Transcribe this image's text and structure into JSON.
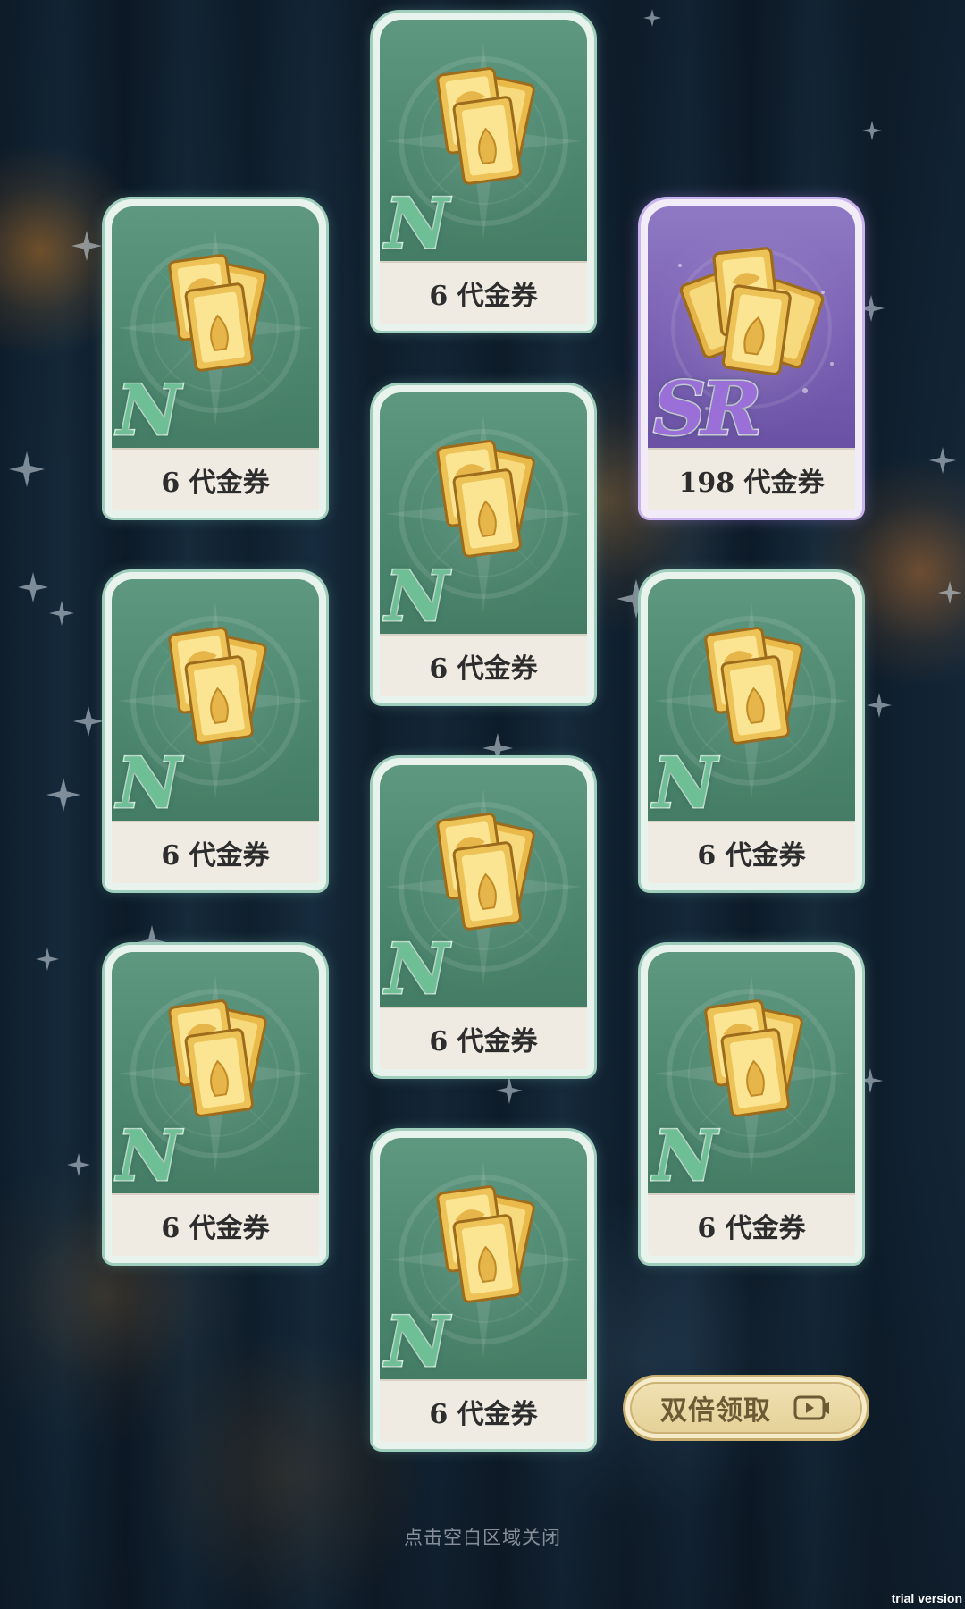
{
  "rewards": {
    "items": [
      {
        "rarity": "N",
        "label": "6 代金券"
      },
      {
        "rarity": "N",
        "label": "6 代金券"
      },
      {
        "rarity": "SR",
        "label": "198 代金券"
      },
      {
        "rarity": "N",
        "label": "6 代金券"
      },
      {
        "rarity": "N",
        "label": "6 代金券"
      },
      {
        "rarity": "N",
        "label": "6 代金券"
      },
      {
        "rarity": "N",
        "label": "6 代金券"
      },
      {
        "rarity": "N",
        "label": "6 代金券"
      },
      {
        "rarity": "N",
        "label": "6 代金券"
      },
      {
        "rarity": "N",
        "label": "6 代金券"
      }
    ]
  },
  "actions": {
    "double_claim_label": "双倍领取",
    "double_claim_icon": "video-icon"
  },
  "footer": {
    "close_hint": "点击空白区域关闭"
  },
  "watermark": "trial version",
  "colors": {
    "card_n": "#4d876f",
    "card_sr": "#7a60b3",
    "button": "#e3cf95"
  }
}
